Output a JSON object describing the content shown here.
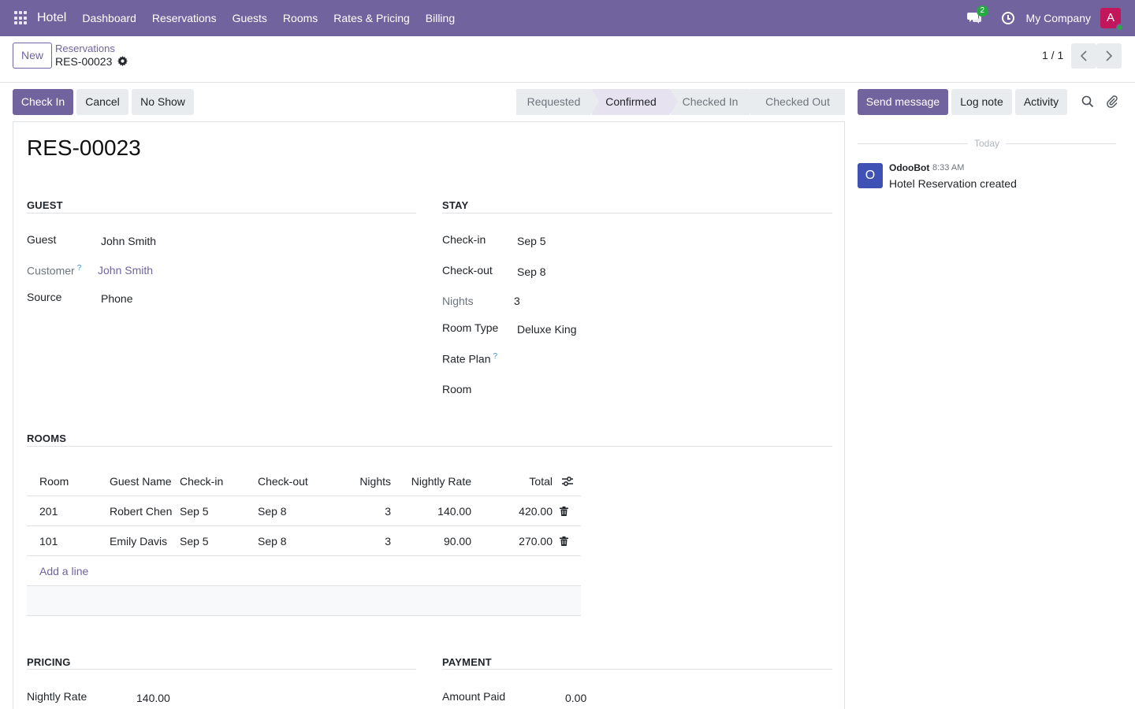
{
  "navbar": {
    "app_name": "Hotel",
    "menu": [
      "Dashboard",
      "Reservations",
      "Guests",
      "Rooms",
      "Rates & Pricing",
      "Billing"
    ],
    "chat_badge": "2",
    "company": "My Company",
    "avatar_letter": "A"
  },
  "control": {
    "new_label": "New",
    "breadcrumb_parent": "Reservations",
    "breadcrumb_current": "RES-00023",
    "pager": "1 / 1"
  },
  "actions": {
    "check_in": "Check In",
    "cancel": "Cancel",
    "no_show": "No Show"
  },
  "stages": [
    "Requested",
    "Confirmed",
    "Checked In",
    "Checked Out"
  ],
  "active_stage": "Confirmed",
  "form": {
    "title": "RES-00023",
    "guest_section": "GUEST",
    "guest_label": "Guest",
    "guest_value": "John Smith",
    "customer_label": "Customer",
    "customer_help": "?",
    "customer_value": "John Smith",
    "source_label": "Source",
    "source_value": "Phone",
    "stay_section": "STAY",
    "checkin_label": "Check-in",
    "checkin_value": "Sep 5",
    "checkout_label": "Check-out",
    "checkout_value": "Sep 8",
    "nights_label": "Nights",
    "nights_value": "3",
    "roomtype_label": "Room Type",
    "roomtype_value": "Deluxe King",
    "rateplan_label": "Rate Plan",
    "rateplan_help": "?",
    "room_label": "Room",
    "rooms_section": "ROOMS",
    "pricing_section": "PRICING",
    "nightly_rate_label": "Nightly Rate",
    "nightly_rate_value": "140.00",
    "payment_section": "PAYMENT",
    "amount_paid_label": "Amount Paid",
    "amount_paid_value": "0.00"
  },
  "rooms_table": {
    "headers": [
      "Room",
      "Guest Name",
      "Check-in",
      "Check-out",
      "Nights",
      "Nightly Rate",
      "Total"
    ],
    "rows": [
      [
        "201",
        "Robert Chen",
        "Sep 5",
        "Sep 8",
        "3",
        "140.00",
        "420.00"
      ],
      [
        "101",
        "Emily Davis",
        "Sep 5",
        "Sep 8",
        "3",
        "90.00",
        "270.00"
      ]
    ],
    "add_line": "Add a line"
  },
  "chatter": {
    "send_message": "Send message",
    "log_note": "Log note",
    "activity": "Activity",
    "today": "Today",
    "avatar_letter": "O",
    "author": "OdooBot",
    "time": "8:33 AM",
    "body": "Hotel Reservation created"
  },
  "colors": {
    "brand": "#71639e",
    "badge": "#28a745",
    "avatar": "#c2185b",
    "bot_avatar": "#3f51b5"
  }
}
